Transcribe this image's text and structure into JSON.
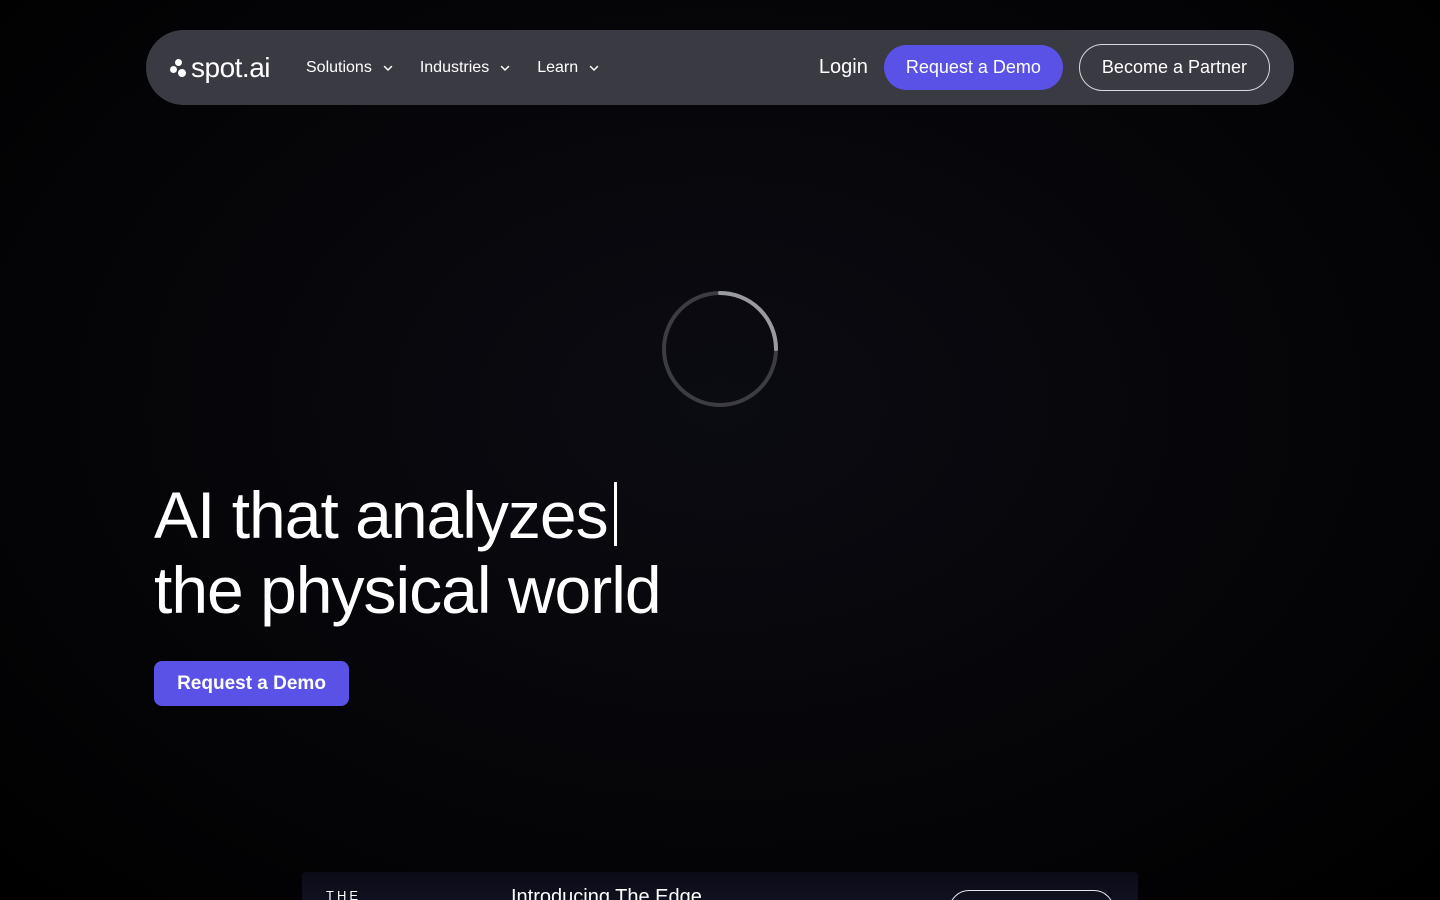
{
  "nav": {
    "logo_text": "spot.ai",
    "menu": [
      {
        "label": "Solutions",
        "icon": "chevron-down-icon"
      },
      {
        "label": "Industries",
        "icon": "chevron-down-icon"
      },
      {
        "label": "Learn",
        "icon": "chevron-down-icon"
      }
    ],
    "login_label": "Login",
    "demo_label": "Request a Demo",
    "partner_label": "Become a Partner"
  },
  "loading": {
    "icon": "loading-spinner-icon"
  },
  "hero": {
    "title_line1": "AI that analyzes",
    "title_line2": "the physical world",
    "cta_label": "Request a Demo"
  },
  "banner": {
    "badge": "THE",
    "title": "Introducing The Edge",
    "button_label": ""
  },
  "colors": {
    "background": "#050508",
    "nav_background": "#3a3a42",
    "accent": "#5a52e6",
    "text": "#ffffff"
  }
}
